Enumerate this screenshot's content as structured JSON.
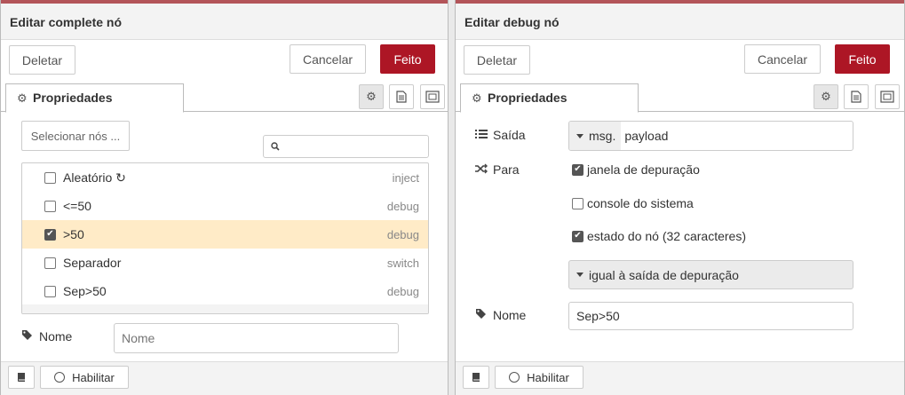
{
  "left": {
    "title": "Editar complete nó",
    "buttons": {
      "delete": "Deletar",
      "cancel": "Cancelar",
      "done": "Feito"
    },
    "tab": "Propriedades",
    "select_nodes": "Selecionar nós ...",
    "search_placeholder": "",
    "nodes": [
      {
        "label": "Aleatório ↻",
        "type": "inject",
        "checked": false
      },
      {
        "label": "<=50",
        "type": "debug",
        "checked": false
      },
      {
        "label": ">50",
        "type": "debug",
        "checked": true
      },
      {
        "label": "Separador",
        "type": "switch",
        "checked": false
      },
      {
        "label": "Sep>50",
        "type": "debug",
        "checked": false
      }
    ],
    "name_label": "Nome",
    "name_placeholder": "Nome",
    "footer_enable": "Habilitar"
  },
  "right": {
    "title": "Editar debug nó",
    "buttons": {
      "delete": "Deletar",
      "cancel": "Cancelar",
      "done": "Feito"
    },
    "tab": "Propriedades",
    "output_label": "Saída",
    "output_prefix": "msg.",
    "output_value": "payload",
    "to_label": "Para",
    "opt_debug_window": "janela de depuração",
    "opt_system_console": "console do sistema",
    "opt_node_status": "estado do nó (32 caracteres)",
    "status_select": "igual à saída de depuração",
    "name_label": "Nome",
    "name_value": "Sep>50",
    "footer_enable": "Habilitar"
  },
  "colors": {
    "primary": "#ad1625",
    "selected_row": "#ffebc7",
    "header_bar": "#a6363c"
  },
  "icons": [
    "gear-icon",
    "description-icon",
    "appearance-icon",
    "search-icon",
    "tag-icon",
    "list-icon",
    "shuffle-icon",
    "book-icon",
    "caret-down-icon"
  ]
}
